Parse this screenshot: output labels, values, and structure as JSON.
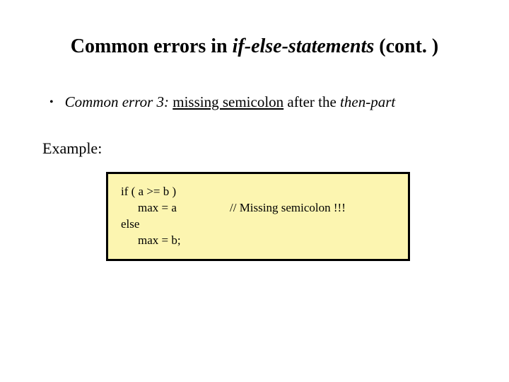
{
  "title": {
    "prefix": "Common errors in ",
    "italic": "if-else-statements",
    "suffix": " (cont. )"
  },
  "bullet": {
    "marker": "•",
    "lead_italic": "Common error 3:",
    "mid_underline": "missing semicolon",
    "after1": " after the ",
    "tail_italic": "then-part"
  },
  "example_label": "Example:",
  "code": {
    "l1": "if ( a >= b )",
    "l2_left": "max = a",
    "l2_comment": "// Missing semicolon !!!",
    "l3": "else",
    "l4": "max = b;"
  }
}
